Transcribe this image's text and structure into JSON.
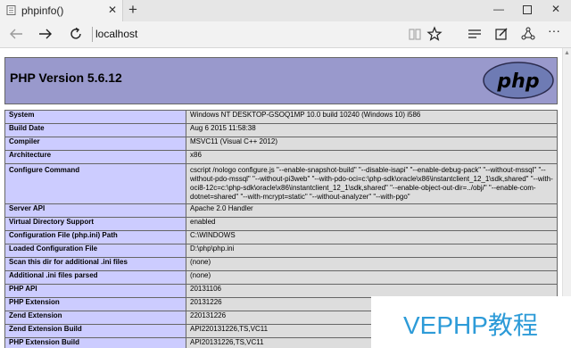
{
  "browser": {
    "tab_title": "phpinfo()",
    "address": "localhost"
  },
  "php": {
    "version_title": "PHP Version 5.6.12",
    "logo_text": "php"
  },
  "info_rows": [
    {
      "key": "System",
      "value": "Windows NT DESKTOP-GSOQ1MP 10.0 build 10240 (Windows 10) i586"
    },
    {
      "key": "Build Date",
      "value": "Aug 6 2015 11:58:38"
    },
    {
      "key": "Compiler",
      "value": "MSVC11 (Visual C++ 2012)"
    },
    {
      "key": "Architecture",
      "value": "x86"
    },
    {
      "key": "Configure Command",
      "value": "cscript /nologo configure.js \"--enable-snapshot-build\" \"--disable-isapi\" \"--enable-debug-pack\" \"--without-mssql\" \"--without-pdo-mssql\" \"--without-pi3web\" \"--with-pdo-oci=c:\\php-sdk\\oracle\\x86\\instantclient_12_1\\sdk,shared\" \"--with-oci8-12c=c:\\php-sdk\\oracle\\x86\\instantclient_12_1\\sdk,shared\" \"--enable-object-out-dir=../obj/\" \"--enable-com-dotnet=shared\" \"--with-mcrypt=static\" \"--without-analyzer\" \"--with-pgo\""
    },
    {
      "key": "Server API",
      "value": "Apache 2.0 Handler"
    },
    {
      "key": "Virtual Directory Support",
      "value": "enabled"
    },
    {
      "key": "Configuration File (php.ini) Path",
      "value": "C:\\WINDOWS"
    },
    {
      "key": "Loaded Configuration File",
      "value": "D:\\php\\php.ini"
    },
    {
      "key": "Scan this dir for additional .ini files",
      "value": "(none)"
    },
    {
      "key": "Additional .ini files parsed",
      "value": "(none)"
    },
    {
      "key": "PHP API",
      "value": "20131106"
    },
    {
      "key": "PHP Extension",
      "value": "20131226"
    },
    {
      "key": "Zend Extension",
      "value": "220131226"
    },
    {
      "key": "Zend Extension Build",
      "value": "API220131226,TS,VC11"
    },
    {
      "key": "PHP Extension Build",
      "value": "API20131226,TS,VC11"
    }
  ],
  "watermark": {
    "text": "VEPHP教程"
  }
}
